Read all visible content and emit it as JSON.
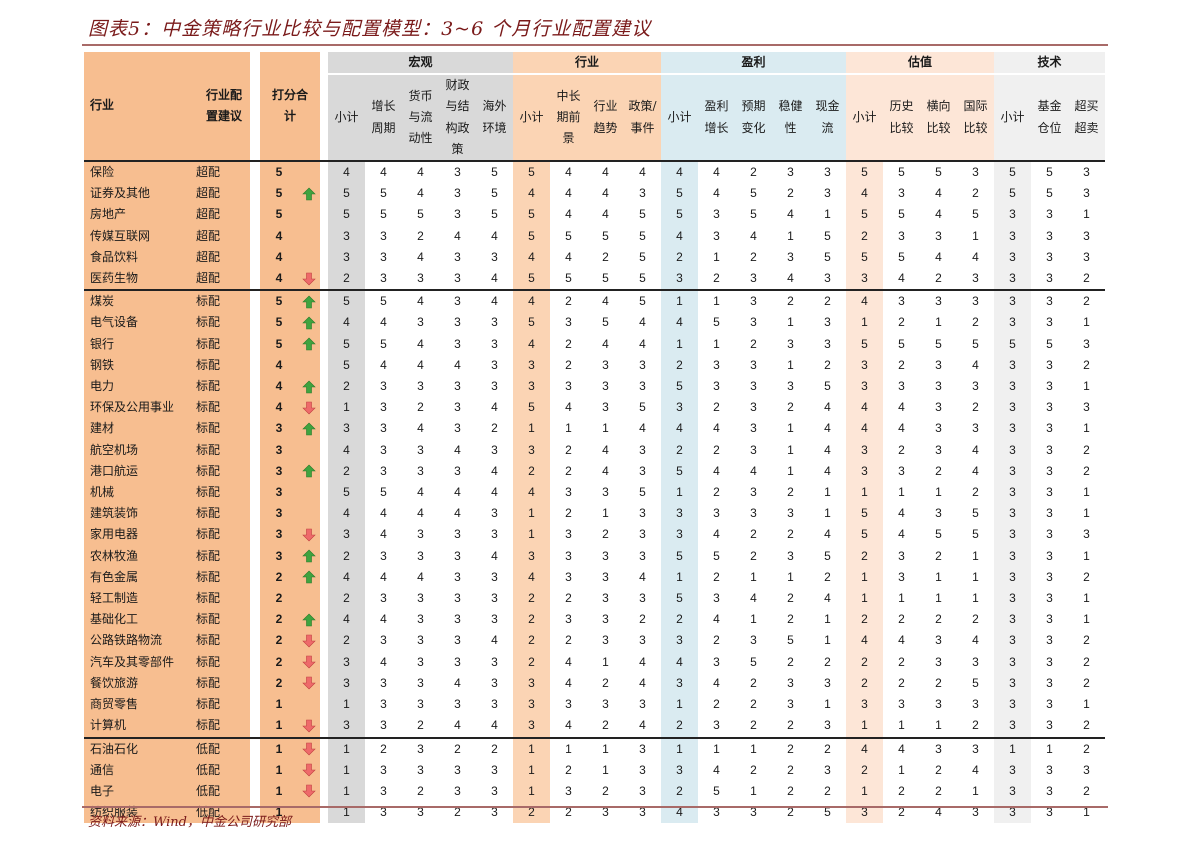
{
  "title": "图表5：中金策略行业比较与配置模型：3~6 个月行业配置建议",
  "source": "资料来源：Wind，中金公司研究部",
  "colors": {
    "accent_dark_red": "#7a1a1a",
    "left_orange": "#f7be90",
    "macro_gray": "#d9d9d9",
    "industry_orange": "#fbd4b4",
    "profit_blue": "#daebf1",
    "valuation_peach": "#fde6d7",
    "tech_gray": "#f0f0f0",
    "arrow_up": "#3a9a3a",
    "arrow_down": "#e05050"
  },
  "header": {
    "industry": "行业",
    "recommendation": "行业配置建议",
    "total_score": "打分合计",
    "groups": [
      {
        "name": "宏观",
        "columns": [
          "小计",
          "增长周期",
          "货币与流动性",
          "财政与结构政策",
          "海外环境"
        ]
      },
      {
        "name": "行业",
        "columns": [
          "小计",
          "中长期前景",
          "行业趋势",
          "政策/事件"
        ]
      },
      {
        "name": "盈利",
        "columns": [
          "小计",
          "盈利增长",
          "预期变化",
          "稳健性",
          "现金流"
        ]
      },
      {
        "name": "估值",
        "columns": [
          "小计",
          "历史比较",
          "横向比较",
          "国际比较"
        ]
      },
      {
        "name": "技术",
        "columns": [
          "小计",
          "基金仓位",
          "超买超卖"
        ]
      }
    ]
  },
  "icons": {
    "up": "arrow-up-icon",
    "down": "arrow-down-icon"
  },
  "rows": [
    {
      "industry": "保险",
      "rec": "超配",
      "score": 5,
      "trend": "",
      "macro": [
        4,
        4,
        4,
        3,
        5
      ],
      "ind": [
        5,
        4,
        4,
        4
      ],
      "prof": [
        4,
        4,
        2,
        3,
        3
      ],
      "val": [
        5,
        5,
        5,
        3
      ],
      "tech": [
        5,
        5,
        3
      ]
    },
    {
      "industry": "证券及其他",
      "rec": "超配",
      "score": 5,
      "trend": "up",
      "macro": [
        5,
        5,
        4,
        3,
        5
      ],
      "ind": [
        4,
        4,
        4,
        3
      ],
      "prof": [
        5,
        4,
        5,
        2,
        3
      ],
      "val": [
        4,
        3,
        4,
        2
      ],
      "tech": [
        5,
        5,
        3
      ]
    },
    {
      "industry": "房地产",
      "rec": "超配",
      "score": 5,
      "trend": "",
      "macro": [
        5,
        5,
        5,
        3,
        5
      ],
      "ind": [
        5,
        4,
        4,
        5
      ],
      "prof": [
        5,
        3,
        5,
        4,
        1
      ],
      "val": [
        5,
        5,
        4,
        5
      ],
      "tech": [
        3,
        3,
        1
      ]
    },
    {
      "industry": "传媒互联网",
      "rec": "超配",
      "score": 4,
      "trend": "",
      "macro": [
        3,
        3,
        2,
        4,
        4
      ],
      "ind": [
        5,
        5,
        5,
        5
      ],
      "prof": [
        4,
        3,
        4,
        1,
        5
      ],
      "val": [
        2,
        3,
        3,
        1
      ],
      "tech": [
        3,
        3,
        3
      ]
    },
    {
      "industry": "食品饮料",
      "rec": "超配",
      "score": 4,
      "trend": "",
      "macro": [
        3,
        3,
        4,
        3,
        3
      ],
      "ind": [
        4,
        4,
        2,
        5
      ],
      "prof": [
        2,
        1,
        2,
        3,
        5
      ],
      "val": [
        5,
        5,
        4,
        4
      ],
      "tech": [
        3,
        3,
        3
      ]
    },
    {
      "industry": "医药生物",
      "rec": "超配",
      "score": 4,
      "trend": "down",
      "macro": [
        2,
        3,
        3,
        3,
        4
      ],
      "ind": [
        5,
        5,
        5,
        5
      ],
      "prof": [
        3,
        2,
        3,
        4,
        3
      ],
      "val": [
        3,
        4,
        2,
        3
      ],
      "tech": [
        3,
        3,
        2
      ]
    },
    {
      "industry": "煤炭",
      "rec": "标配",
      "score": 5,
      "trend": "up",
      "macro": [
        5,
        5,
        4,
        3,
        4
      ],
      "ind": [
        4,
        2,
        4,
        5
      ],
      "prof": [
        1,
        1,
        3,
        2,
        2
      ],
      "val": [
        4,
        3,
        3,
        3
      ],
      "tech": [
        3,
        3,
        2
      ]
    },
    {
      "industry": "电气设备",
      "rec": "标配",
      "score": 5,
      "trend": "up",
      "macro": [
        4,
        4,
        3,
        3,
        3
      ],
      "ind": [
        5,
        3,
        5,
        4
      ],
      "prof": [
        4,
        5,
        3,
        1,
        3
      ],
      "val": [
        1,
        2,
        1,
        2
      ],
      "tech": [
        3,
        3,
        1
      ]
    },
    {
      "industry": "银行",
      "rec": "标配",
      "score": 5,
      "trend": "up",
      "macro": [
        5,
        5,
        4,
        3,
        3
      ],
      "ind": [
        4,
        2,
        4,
        4
      ],
      "prof": [
        1,
        1,
        2,
        3,
        3
      ],
      "val": [
        5,
        5,
        5,
        5
      ],
      "tech": [
        5,
        5,
        3
      ]
    },
    {
      "industry": "钢铁",
      "rec": "标配",
      "score": 4,
      "trend": "",
      "macro": [
        5,
        4,
        4,
        4,
        3
      ],
      "ind": [
        3,
        2,
        3,
        3
      ],
      "prof": [
        2,
        3,
        3,
        1,
        2
      ],
      "val": [
        3,
        2,
        3,
        4
      ],
      "tech": [
        3,
        3,
        2
      ]
    },
    {
      "industry": "电力",
      "rec": "标配",
      "score": 4,
      "trend": "up",
      "macro": [
        2,
        3,
        3,
        3,
        3
      ],
      "ind": [
        3,
        3,
        3,
        3
      ],
      "prof": [
        5,
        3,
        3,
        3,
        5
      ],
      "val": [
        3,
        3,
        3,
        3
      ],
      "tech": [
        3,
        3,
        1
      ]
    },
    {
      "industry": "环保及公用事业",
      "rec": "标配",
      "score": 4,
      "trend": "down",
      "macro": [
        1,
        3,
        2,
        3,
        4
      ],
      "ind": [
        5,
        4,
        3,
        5
      ],
      "prof": [
        3,
        2,
        3,
        2,
        4
      ],
      "val": [
        4,
        4,
        3,
        2
      ],
      "tech": [
        3,
        3,
        3
      ]
    },
    {
      "industry": "建材",
      "rec": "标配",
      "score": 3,
      "trend": "up",
      "macro": [
        3,
        3,
        4,
        3,
        2
      ],
      "ind": [
        1,
        1,
        1,
        4
      ],
      "prof": [
        4,
        4,
        3,
        1,
        4
      ],
      "val": [
        4,
        4,
        3,
        3
      ],
      "tech": [
        3,
        3,
        1
      ]
    },
    {
      "industry": "航空机场",
      "rec": "标配",
      "score": 3,
      "trend": "",
      "macro": [
        4,
        3,
        3,
        4,
        3
      ],
      "ind": [
        3,
        2,
        4,
        3
      ],
      "prof": [
        2,
        2,
        3,
        1,
        4
      ],
      "val": [
        3,
        2,
        3,
        4
      ],
      "tech": [
        3,
        3,
        2
      ]
    },
    {
      "industry": "港口航运",
      "rec": "标配",
      "score": 3,
      "trend": "up",
      "macro": [
        2,
        3,
        3,
        3,
        4
      ],
      "ind": [
        2,
        2,
        4,
        3
      ],
      "prof": [
        5,
        4,
        4,
        1,
        4
      ],
      "val": [
        3,
        3,
        2,
        4
      ],
      "tech": [
        3,
        3,
        2
      ]
    },
    {
      "industry": "机械",
      "rec": "标配",
      "score": 3,
      "trend": "",
      "macro": [
        5,
        5,
        4,
        4,
        4
      ],
      "ind": [
        4,
        3,
        3,
        5
      ],
      "prof": [
        1,
        2,
        3,
        2,
        1
      ],
      "val": [
        1,
        1,
        1,
        2
      ],
      "tech": [
        3,
        3,
        1
      ]
    },
    {
      "industry": "建筑装饰",
      "rec": "标配",
      "score": 3,
      "trend": "",
      "macro": [
        4,
        4,
        4,
        4,
        3
      ],
      "ind": [
        1,
        2,
        1,
        3
      ],
      "prof": [
        3,
        3,
        3,
        3,
        1
      ],
      "val": [
        5,
        4,
        3,
        5
      ],
      "tech": [
        3,
        3,
        1
      ]
    },
    {
      "industry": "家用电器",
      "rec": "标配",
      "score": 3,
      "trend": "down",
      "macro": [
        3,
        4,
        3,
        3,
        3
      ],
      "ind": [
        1,
        3,
        2,
        3
      ],
      "prof": [
        3,
        4,
        2,
        2,
        4
      ],
      "val": [
        5,
        4,
        5,
        5
      ],
      "tech": [
        3,
        3,
        3
      ]
    },
    {
      "industry": "农林牧渔",
      "rec": "标配",
      "score": 3,
      "trend": "up",
      "macro": [
        2,
        3,
        3,
        3,
        4
      ],
      "ind": [
        3,
        3,
        3,
        3
      ],
      "prof": [
        5,
        5,
        2,
        3,
        5
      ],
      "val": [
        2,
        3,
        2,
        1
      ],
      "tech": [
        3,
        3,
        1
      ]
    },
    {
      "industry": "有色金属",
      "rec": "标配",
      "score": 2,
      "trend": "up",
      "macro": [
        4,
        4,
        4,
        3,
        3
      ],
      "ind": [
        4,
        3,
        3,
        4
      ],
      "prof": [
        1,
        2,
        1,
        1,
        2
      ],
      "val": [
        1,
        3,
        1,
        1
      ],
      "tech": [
        3,
        3,
        2
      ]
    },
    {
      "industry": "轻工制造",
      "rec": "标配",
      "score": 2,
      "trend": "",
      "macro": [
        2,
        3,
        3,
        3,
        3
      ],
      "ind": [
        2,
        2,
        3,
        3
      ],
      "prof": [
        5,
        3,
        4,
        2,
        4
      ],
      "val": [
        1,
        1,
        1,
        1
      ],
      "tech": [
        3,
        3,
        1
      ]
    },
    {
      "industry": "基础化工",
      "rec": "标配",
      "score": 2,
      "trend": "up",
      "macro": [
        4,
        4,
        3,
        3,
        3
      ],
      "ind": [
        2,
        3,
        3,
        2
      ],
      "prof": [
        2,
        4,
        1,
        2,
        1
      ],
      "val": [
        2,
        2,
        2,
        2
      ],
      "tech": [
        3,
        3,
        1
      ]
    },
    {
      "industry": "公路铁路物流",
      "rec": "标配",
      "score": 2,
      "trend": "down",
      "macro": [
        2,
        3,
        3,
        3,
        4
      ],
      "ind": [
        2,
        2,
        3,
        3
      ],
      "prof": [
        3,
        2,
        3,
        5,
        1
      ],
      "val": [
        4,
        4,
        3,
        4
      ],
      "tech": [
        3,
        3,
        2
      ]
    },
    {
      "industry": "汽车及其零部件",
      "rec": "标配",
      "score": 2,
      "trend": "down",
      "macro": [
        3,
        4,
        3,
        3,
        3
      ],
      "ind": [
        2,
        4,
        1,
        4
      ],
      "prof": [
        4,
        3,
        5,
        2,
        2
      ],
      "val": [
        2,
        2,
        3,
        3
      ],
      "tech": [
        3,
        3,
        2
      ]
    },
    {
      "industry": "餐饮旅游",
      "rec": "标配",
      "score": 2,
      "trend": "down",
      "macro": [
        3,
        3,
        3,
        4,
        3
      ],
      "ind": [
        3,
        4,
        2,
        4
      ],
      "prof": [
        3,
        4,
        2,
        3,
        3
      ],
      "val": [
        2,
        2,
        2,
        5
      ],
      "tech": [
        3,
        3,
        2
      ]
    },
    {
      "industry": "商贸零售",
      "rec": "标配",
      "score": 1,
      "trend": "",
      "macro": [
        1,
        3,
        3,
        3,
        3
      ],
      "ind": [
        3,
        3,
        3,
        3
      ],
      "prof": [
        1,
        2,
        2,
        3,
        1
      ],
      "val": [
        3,
        3,
        3,
        3
      ],
      "tech": [
        3,
        3,
        1
      ]
    },
    {
      "industry": "计算机",
      "rec": "标配",
      "score": 1,
      "trend": "down",
      "macro": [
        3,
        3,
        2,
        4,
        4
      ],
      "ind": [
        3,
        4,
        2,
        4
      ],
      "prof": [
        2,
        3,
        2,
        2,
        3
      ],
      "val": [
        1,
        1,
        1,
        2
      ],
      "tech": [
        3,
        3,
        2
      ]
    },
    {
      "industry": "石油石化",
      "rec": "低配",
      "score": 1,
      "trend": "down",
      "macro": [
        1,
        2,
        3,
        2,
        2
      ],
      "ind": [
        1,
        1,
        1,
        3
      ],
      "prof": [
        1,
        1,
        1,
        2,
        2
      ],
      "val": [
        4,
        4,
        3,
        3
      ],
      "tech": [
        1,
        1,
        2
      ]
    },
    {
      "industry": "通信",
      "rec": "低配",
      "score": 1,
      "trend": "down",
      "macro": [
        1,
        3,
        3,
        3,
        3
      ],
      "ind": [
        1,
        2,
        1,
        3
      ],
      "prof": [
        3,
        4,
        2,
        2,
        3
      ],
      "val": [
        2,
        1,
        2,
        4
      ],
      "tech": [
        3,
        3,
        3
      ]
    },
    {
      "industry": "电子",
      "rec": "低配",
      "score": 1,
      "trend": "down",
      "macro": [
        1,
        3,
        2,
        3,
        3
      ],
      "ind": [
        1,
        3,
        2,
        3
      ],
      "prof": [
        2,
        5,
        1,
        2,
        2
      ],
      "val": [
        1,
        2,
        2,
        1
      ],
      "tech": [
        3,
        3,
        2
      ]
    },
    {
      "industry": "纺织服装",
      "rec": "低配",
      "score": 1,
      "trend": "",
      "macro": [
        1,
        3,
        3,
        2,
        3
      ],
      "ind": [
        2,
        2,
        3,
        3
      ],
      "prof": [
        4,
        3,
        3,
        2,
        5
      ],
      "val": [
        3,
        2,
        4,
        3
      ],
      "tech": [
        3,
        3,
        1
      ]
    }
  ],
  "group_breaks_before_rows": [
    6,
    27
  ]
}
